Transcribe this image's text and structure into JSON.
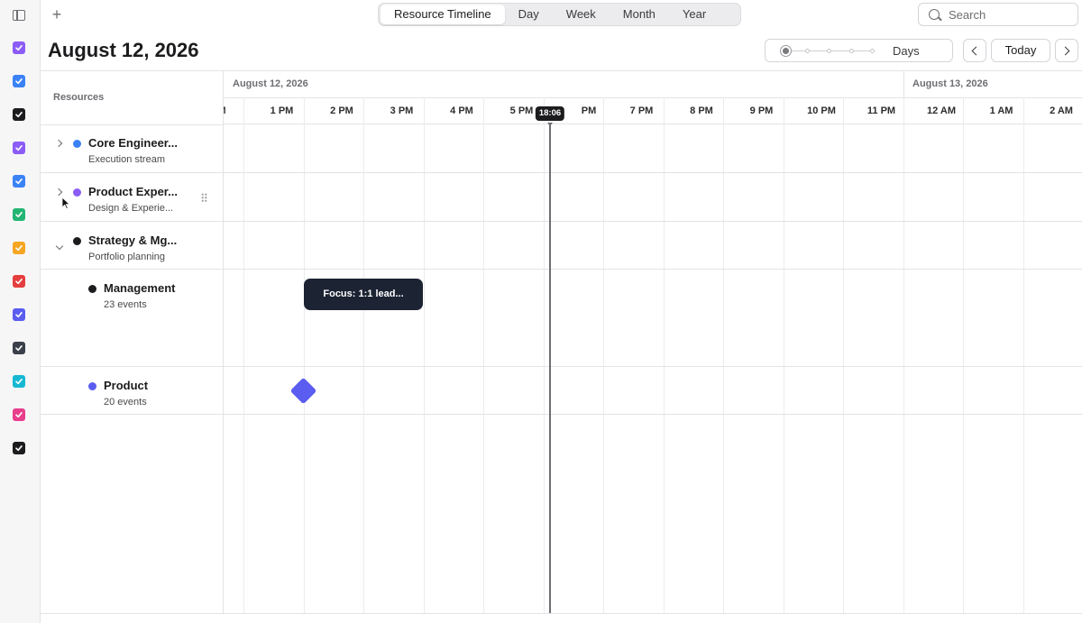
{
  "colors": {
    "accent": "#5b5cf0",
    "now_line": "#6e6e73",
    "event_dark": "#1c2333"
  },
  "sidebar": {
    "toggle_icon": "sidebar-toggle-icon",
    "calendars": [
      {
        "color": "#8b5cf6",
        "checked": true
      },
      {
        "color": "#3b82f6",
        "checked": true
      },
      {
        "color": "#1c1c1e",
        "checked": true
      },
      {
        "color": "#8b5cf6",
        "checked": true
      },
      {
        "color": "#3b82f6",
        "checked": true
      },
      {
        "color": "#22b573",
        "checked": true
      },
      {
        "color": "#f5a623",
        "checked": true
      },
      {
        "color": "#e53e3e",
        "checked": true
      },
      {
        "color": "#5b5cf0",
        "checked": true
      },
      {
        "color": "#3a3f4b",
        "checked": true
      },
      {
        "color": "#17b8d1",
        "checked": true
      },
      {
        "color": "#e83e8c",
        "checked": true
      },
      {
        "color": "#1c1c1e",
        "checked": true
      }
    ]
  },
  "toolbar": {
    "add_label": "+",
    "views": [
      "Resource Timeline",
      "Day",
      "Week",
      "Month",
      "Year"
    ],
    "active_view": "Resource Timeline",
    "search_placeholder": "Search"
  },
  "header": {
    "title": "August 12, 2026",
    "zoom_label": "Days",
    "today_label": "Today"
  },
  "resources_header": "Resources",
  "timeline": {
    "date_labels": [
      "August 12, 2026",
      "August 13, 2026"
    ],
    "hours": [
      "M",
      "1 PM",
      "2 PM",
      "3 PM",
      "4 PM",
      "5 PM",
      "PM",
      "7 PM",
      "8 PM",
      "9 PM",
      "10 PM",
      "11 PM",
      "12 AM",
      "1 AM",
      "2 AM"
    ],
    "now_label": "18:06"
  },
  "resources": [
    {
      "title": "Core Engineer...",
      "subtitle": "Execution stream",
      "color": "#3b82f6",
      "state": "collapsed"
    },
    {
      "title": "Product Exper...",
      "subtitle": "Design & Experie...",
      "color": "#8b5cf6",
      "state": "collapsed"
    },
    {
      "title": "Strategy & Mg...",
      "subtitle": "Portfolio planning",
      "color": "#1c1c1e",
      "state": "expanded"
    },
    {
      "title": "Management",
      "subtitle": "23 events",
      "color": "#1c1c1e",
      "state": "child"
    },
    {
      "title": "Product",
      "subtitle": "20 events",
      "color": "#5b5cf0",
      "state": "child"
    }
  ],
  "events": [
    {
      "label": "Focus: 1:1 lead..."
    }
  ]
}
